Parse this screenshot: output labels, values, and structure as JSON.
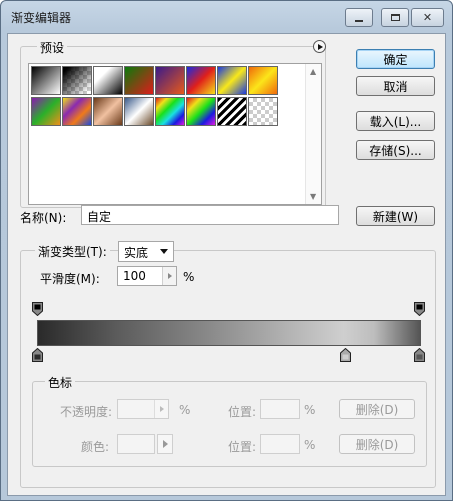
{
  "window": {
    "title": "渐变编辑器"
  },
  "presets": {
    "label": "预设",
    "swatches": [
      {
        "name": "black-white",
        "css": "linear-gradient(135deg,#000,#fff)"
      },
      {
        "name": "black-transparent",
        "css": "linear-gradient(135deg,#000 10%,transparent 90%),repeating-conic-gradient(#ccc 0 25%,#fff 0 50%) 0 0/8px 8px"
      },
      {
        "name": "black-white-2",
        "css": "linear-gradient(135deg,#fff 30%,#000)"
      },
      {
        "name": "red-green",
        "css": "linear-gradient(135deg,#0b7a0b,#e01b1b)"
      },
      {
        "name": "violet-orange",
        "css": "linear-gradient(135deg,#3a1a8a,#e85a1a)"
      },
      {
        "name": "blue-red-yellow",
        "css": "linear-gradient(135deg,#1a2ae0,#e0201a 50%,#f5e01a)"
      },
      {
        "name": "blue-yellow-blue",
        "css": "linear-gradient(135deg,#1a3ae0,#f8e81a 50%,#1a3ae0)"
      },
      {
        "name": "orange-yellow-orange",
        "css": "linear-gradient(135deg,#f06a0a,#fbe51a 50%,#f06a0a)"
      },
      {
        "name": "violet-green-orange",
        "css": "linear-gradient(135deg,#8a1ab0,#2ab02a 50%,#f0901a)"
      },
      {
        "name": "yellow-violet-orange-blue",
        "css": "linear-gradient(135deg,#f0e01a,#8a2ab0 35%,#f07a1a 65%,#1a4ae0)"
      },
      {
        "name": "copper",
        "css": "linear-gradient(135deg,#6a3a1a,#f0c0a0 50%,#6a3a1a)"
      },
      {
        "name": "chrome",
        "css": "linear-gradient(135deg,#3a5a8a,#fff 50%,#6a4a2a)"
      },
      {
        "name": "spectrum",
        "css": "linear-gradient(135deg,#e01a1a,#f0e01a,#1ae01a,#1ae0e0,#1a1ae0,#e01ae0)"
      },
      {
        "name": "transparent-rainbow",
        "css": "linear-gradient(135deg,#e01a1a,#f0e01a,#1ae01a,#1a1ae0,#e01ae0)"
      },
      {
        "name": "transparent-stripes",
        "css": "repeating-linear-gradient(135deg,#000 0 3px,#fff 3px 6px)"
      },
      {
        "name": "neutral-density",
        "css": "repeating-conic-gradient(#ccc 0 25%,#fff 0 50%) 0 0/8px 8px"
      }
    ]
  },
  "buttons": {
    "ok": "确定",
    "cancel": "取消",
    "load": "载入(L)...",
    "save": "存储(S)...",
    "new": "新建(W)"
  },
  "name_field": {
    "label": "名称(N):",
    "value": "自定"
  },
  "gradient_type": {
    "label": "渐变类型(T):",
    "value": "实底",
    "smoothness_label": "平滑度(M):",
    "smoothness_value": "100",
    "smoothness_unit": "%"
  },
  "stops": {
    "group_label": "色标",
    "opacity_label": "不透明度:",
    "opacity_unit": "%",
    "opacity_location_label": "位置:",
    "opacity_location_unit": "%",
    "opacity_delete": "删除(D)",
    "color_label": "颜色:",
    "color_location_label": "位置:",
    "color_location_unit": "%",
    "color_delete": "删除(D)"
  }
}
